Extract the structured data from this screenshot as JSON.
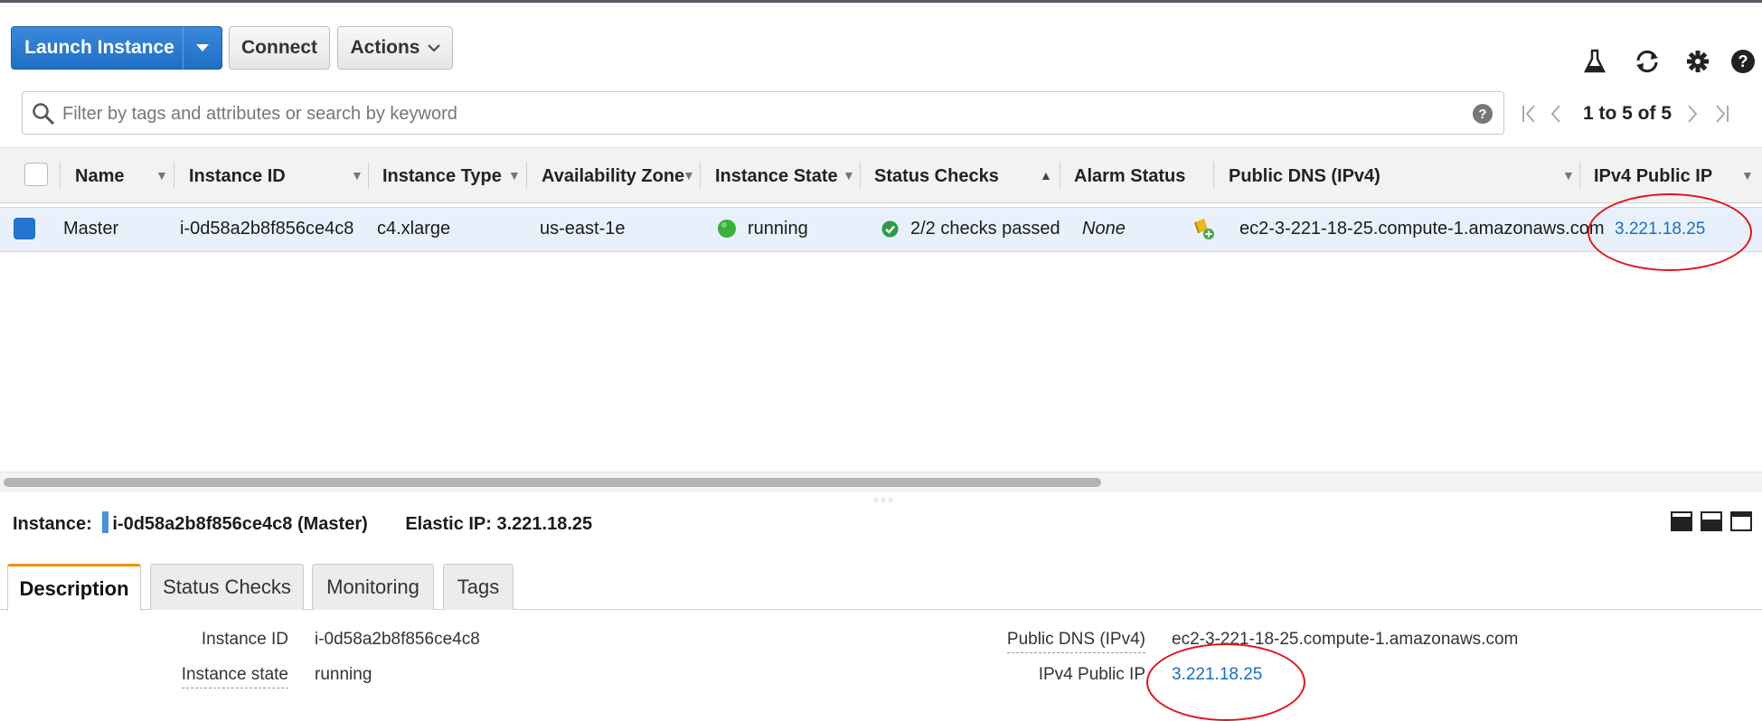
{
  "toolbar": {
    "launch_label": "Launch Instance",
    "connect_label": "Connect",
    "actions_label": "Actions"
  },
  "icons": {
    "flask": "flask-icon",
    "refresh": "refresh-icon",
    "settings": "gear-icon",
    "help": "help-icon",
    "search": "search-icon"
  },
  "search": {
    "placeholder": "Filter by tags and attributes or search by keyword"
  },
  "pagination": {
    "label": "1 to 5 of 5"
  },
  "table": {
    "columns": [
      "Name",
      "Instance ID",
      "Instance Type",
      "Availability Zone",
      "Instance State",
      "Status Checks",
      "Alarm Status",
      "Public DNS (IPv4)",
      "IPv4 Public IP"
    ],
    "row": {
      "name": "Master",
      "instance_id": "i-0d58a2b8f856ce4c8",
      "instance_type": "c4.xlarge",
      "zone": "us-east-1e",
      "state": "running",
      "status_checks": "2/2 checks passed",
      "alarm_status": "None",
      "public_dns": "ec2-3-221-18-25.compute-1.amazonaws.com",
      "public_ip": "3.221.18.25"
    }
  },
  "details": {
    "instance_prefix": "Instance:",
    "instance_title": "i-0d58a2b8f856ce4c8 (Master)",
    "elastic_ip": "Elastic IP: 3.221.18.25",
    "tabs": [
      "Description",
      "Status Checks",
      "Monitoring",
      "Tags"
    ],
    "fields": {
      "instance_id_label": "Instance ID",
      "instance_id_value": "i-0d58a2b8f856ce4c8",
      "instance_state_label": "Instance state",
      "instance_state_value": "running",
      "public_dns_label": "Public DNS (IPv4)",
      "public_dns_value": "ec2-3-221-18-25.compute-1.amazonaws.com",
      "public_ip_label": "IPv4 Public IP",
      "public_ip_value": "3.221.18.25"
    }
  },
  "colors": {
    "primary": "#2475cf",
    "link": "#1a6ec1",
    "running": "#3bb03b",
    "tab_accent": "#f29111",
    "annotation": "#e4131a"
  }
}
